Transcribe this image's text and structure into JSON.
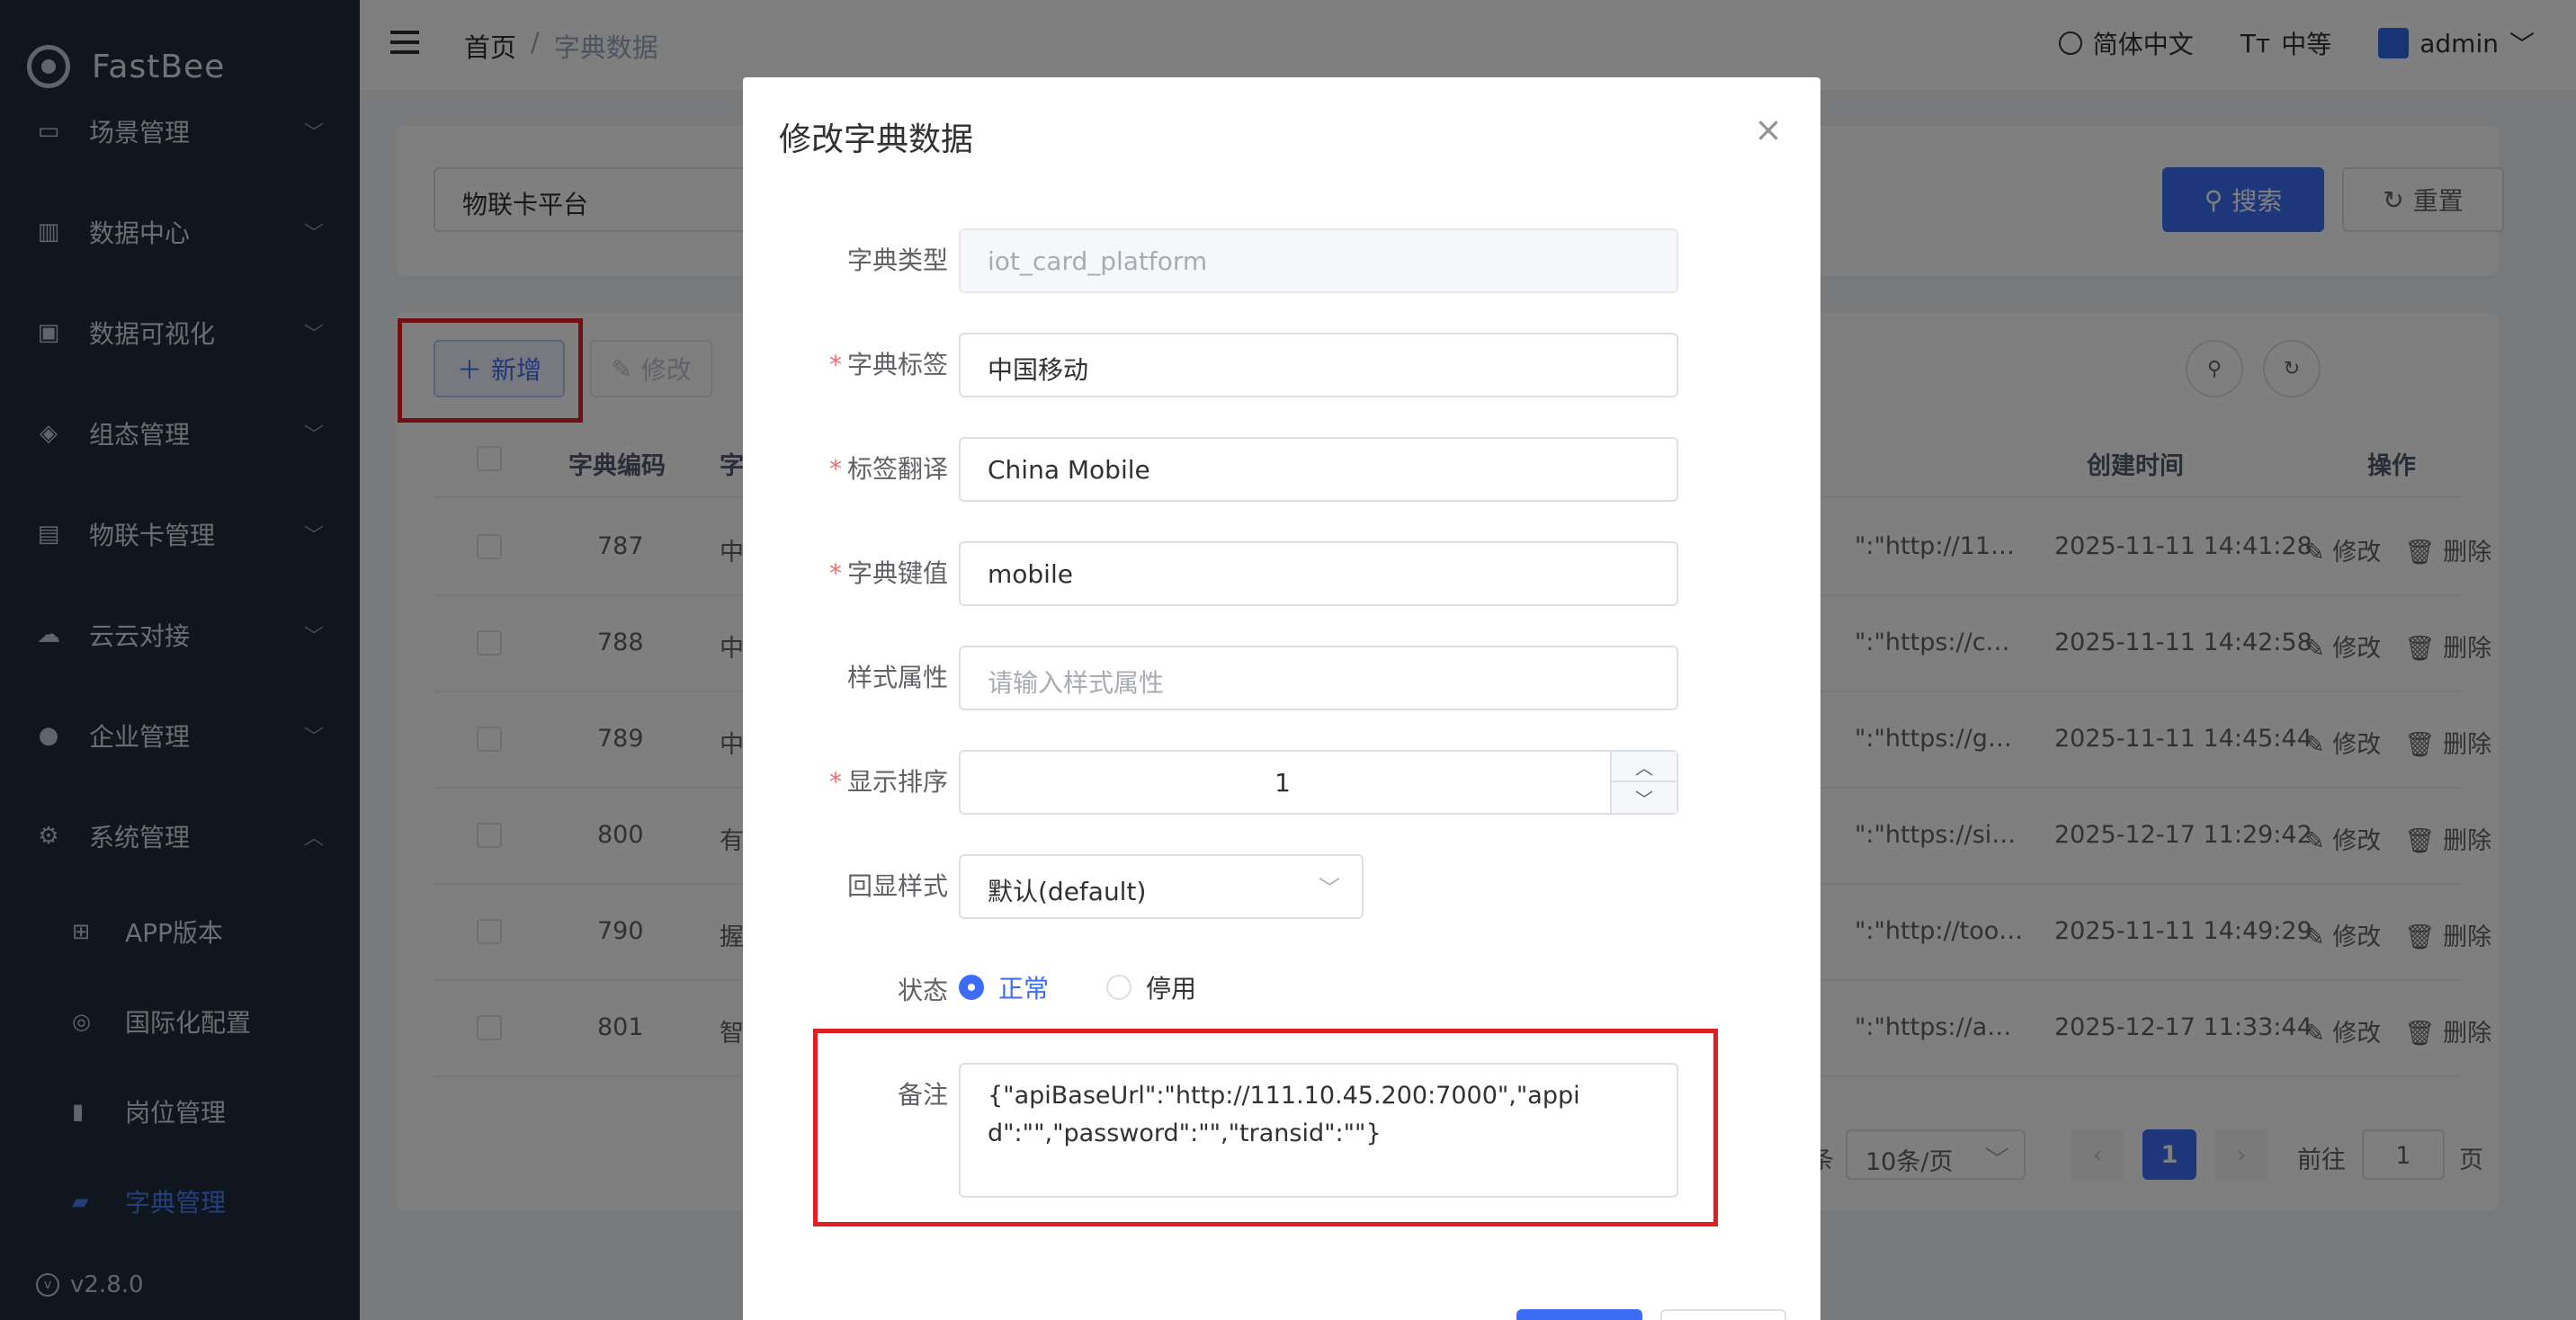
{
  "sidebar": {
    "logo": "FastBee",
    "items": [
      {
        "label": "场景管理",
        "icon": "scene-icon"
      },
      {
        "label": "数据中心",
        "icon": "chart-icon"
      },
      {
        "label": "数据可视化",
        "icon": "monitor-icon"
      },
      {
        "label": "组态管理",
        "icon": "layers-icon"
      },
      {
        "label": "物联卡管理",
        "icon": "sim-card-icon"
      },
      {
        "label": "云云对接",
        "icon": "cloud-icon"
      },
      {
        "label": "企业管理",
        "icon": "enterprise-icon"
      },
      {
        "label": "系统管理",
        "icon": "settings-icon"
      }
    ],
    "sub_items": [
      {
        "label": "APP版本",
        "icon": "grid-icon"
      },
      {
        "label": "国际化配置",
        "icon": "globe-icon"
      },
      {
        "label": "岗位管理",
        "icon": "badge-icon"
      },
      {
        "label": "字典管理",
        "icon": "book-icon"
      }
    ],
    "version": "v2.8.0"
  },
  "header": {
    "breadcrumb": {
      "home": "首页",
      "sep": "/",
      "current": "字典数据"
    },
    "language": "简体中文",
    "size": "中等",
    "user": "admin"
  },
  "search": {
    "input_value": "物联卡平台",
    "search_label": "搜索",
    "reset_label": "重置"
  },
  "toolbar": {
    "add_label": "新增",
    "edit_label": "修改"
  },
  "table": {
    "headers": {
      "code": "字典编码",
      "label": "字",
      "created": "创建时间",
      "ops": "操作"
    },
    "rows": [
      {
        "code": "787",
        "label": "中",
        "remark": "\":\"http://11…",
        "created": "2025-11-11 14:41:28"
      },
      {
        "code": "788",
        "label": "中",
        "remark": "\":\"https://c…",
        "created": "2025-11-11 14:42:58"
      },
      {
        "code": "789",
        "label": "中",
        "remark": "\":\"https://g…",
        "created": "2025-11-11 14:45:44"
      },
      {
        "code": "800",
        "label": "有",
        "remark": "\":\"https://si…",
        "created": "2025-12-17 11:29:42"
      },
      {
        "code": "790",
        "label": "握",
        "remark": "\":\"http://too…",
        "created": "2025-11-11 14:49:29"
      },
      {
        "code": "801",
        "label": "智",
        "remark": "\":\"https://a…",
        "created": "2025-12-17 11:33:44"
      }
    ],
    "op_edit": "修改",
    "op_delete": "删除"
  },
  "pagination": {
    "total_suffix": "条",
    "page_size": "10条/页",
    "current_page": "1",
    "goto_prefix": "前往",
    "goto_value": "1",
    "goto_suffix": "页"
  },
  "dialog": {
    "title": "修改字典数据",
    "fields": {
      "dict_type_label": "字典类型",
      "dict_type_value": "iot_card_platform",
      "dict_label_label": "字典标签",
      "dict_label_value": "中国移动",
      "translation_label": "标签翻译",
      "translation_value": "China Mobile",
      "dict_value_label": "字典键值",
      "dict_value_value": "mobile",
      "css_label": "样式属性",
      "css_placeholder": "请输入样式属性",
      "sort_label": "显示排序",
      "sort_value": "1",
      "echo_label": "回显样式",
      "echo_value": "默认(default)",
      "status_label": "状态",
      "status_normal": "正常",
      "status_disabled": "停用",
      "remark_label": "备注",
      "remark_value": "{\"apiBaseUrl\":\"http://111.10.45.200:7000\",\"appid\":\"\",\"password\":\"\",\"transid\":\"\"}"
    }
  },
  "colors": {
    "primary": "#3c6cf5",
    "sidebar_bg": "#1f2d3d",
    "highlight": "#e02020"
  }
}
